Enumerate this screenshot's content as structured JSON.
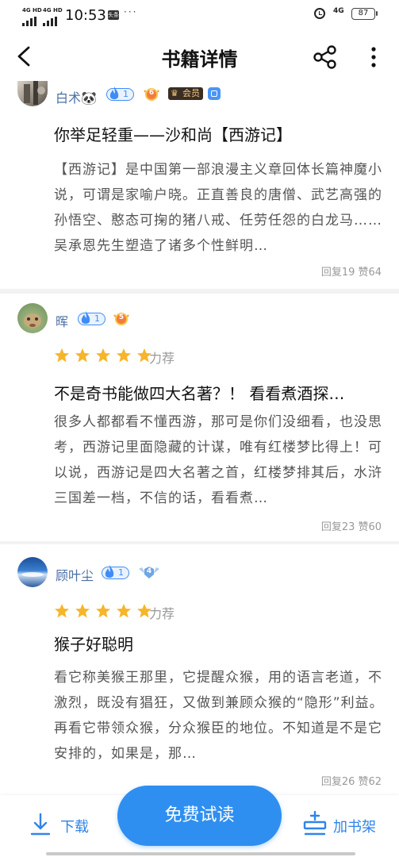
{
  "status_bar": {
    "sim1": "4G HD",
    "sim2": "4G HD",
    "time": "10:53",
    "app_badge": "头条",
    "network": "4G",
    "battery": "87"
  },
  "nav": {
    "title": "书籍详情",
    "icons": [
      "back-icon",
      "share-icon",
      "more-icon"
    ]
  },
  "comments": [
    {
      "user": "白术🐼",
      "level": "1",
      "medal": "6",
      "vip_label": "会员",
      "title": "你举足轻重——沙和尚【西游记】",
      "body": "【西游记】是中国第一部浪漫主义章回体长篇神魔小说，可谓是家喻户晓。正直善良的唐僧、武艺高强的孙悟空、憨态可掬的猪八戒、任劳任怨的白龙马……吴承恩先生塑造了诸多个性鲜明…",
      "replies": "回复19",
      "likes": "赞64"
    },
    {
      "user": "晖",
      "level": "1",
      "medal": "5",
      "rating_stars": 5,
      "rating_label": "力荐",
      "title": "不是奇书能做四大名著？！ 看看煮酒探…",
      "body": "很多人都都看不懂西游，那可是你们没细看，也没思考，西游记里面隐藏的计谋，唯有红楼梦比得上！可以说，西游记是四大名著之首，红楼梦排其后，水浒三国差一档，不信的话，看看煮…",
      "replies": "回复23",
      "likes": "赞60"
    },
    {
      "user": "顾叶尘",
      "level": "1",
      "medal": "4",
      "rating_stars": 5,
      "rating_label": "力荐",
      "title": "猴子好聪明",
      "body": "看它称美猴王那里，它提醒众猴，用的语言老道，不激烈，既没有猖狂，又做到兼顾众猴的“隐形”利益。再看它带领众猴，分众猴臣的地位。不知道是不是它安排的，如果是，那…",
      "replies": "回复26",
      "likes": "赞62"
    }
  ],
  "bottom_bar": {
    "download_label": "下载",
    "read_label": "免费试读",
    "shelf_label": "加书架"
  },
  "colors": {
    "accent": "#2f8ff0",
    "star": "#f7b52c",
    "username": "#4a6fa5"
  }
}
